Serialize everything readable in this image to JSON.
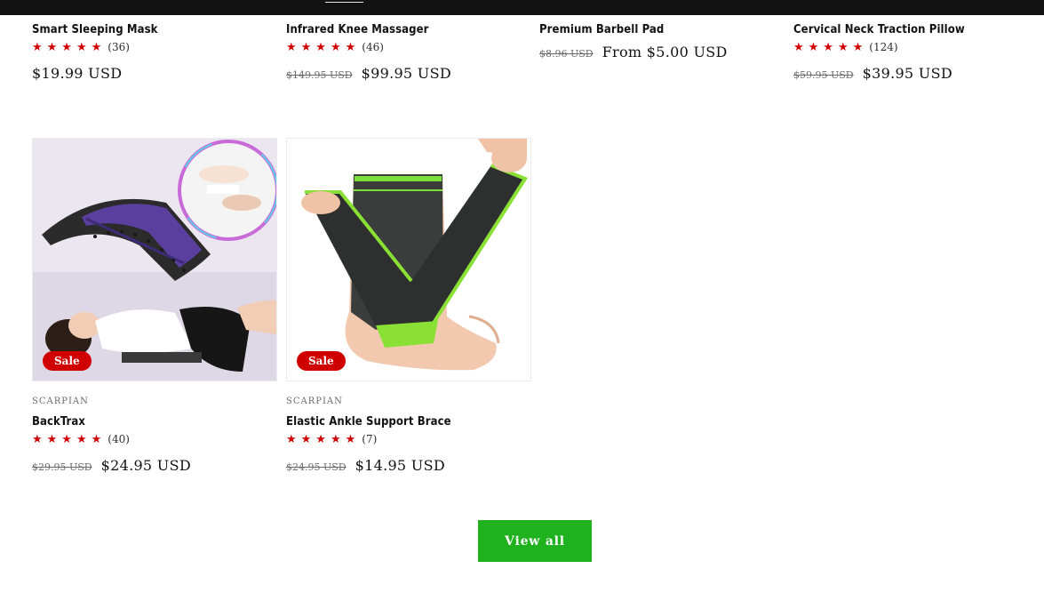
{
  "products_row1": [
    {
      "title": "Smart Sleeping Mask",
      "stars": "★★★★★",
      "count": "(36)",
      "old_price": "",
      "price": "$19.99 USD"
    },
    {
      "title": "Infrared Knee Massager",
      "stars": "★★★★★",
      "count": "(46)",
      "old_price": "$149.95 USD",
      "price": "$99.95 USD"
    },
    {
      "title": "Premium Barbell Pad",
      "stars": "",
      "count": "",
      "old_price": "$8.96 USD",
      "price": "From $5.00 USD"
    },
    {
      "title": "Cervical Neck Traction Pillow",
      "stars": "★★★★★",
      "count": "(124)",
      "old_price": "$59.95 USD",
      "price": "$39.95 USD"
    }
  ],
  "products_row2": [
    {
      "badge": "Sale",
      "vendor": "SCARPIAN",
      "title": "BackTrax",
      "stars": "★★★★★",
      "count": "(40)",
      "old_price": "$29.95 USD",
      "price": "$24.95 USD"
    },
    {
      "badge": "Sale",
      "vendor": "SCARPIAN",
      "title": "Elastic Ankle Support Brace",
      "stars": "★★★★★",
      "count": "(7)",
      "old_price": "$24.95 USD",
      "price": "$14.95 USD"
    }
  ],
  "view_all_label": "View all",
  "colors": {
    "accent_green": "#20b21e",
    "sale_red": "#d10000",
    "star_red": "#d10000",
    "topbar": "#121212"
  }
}
